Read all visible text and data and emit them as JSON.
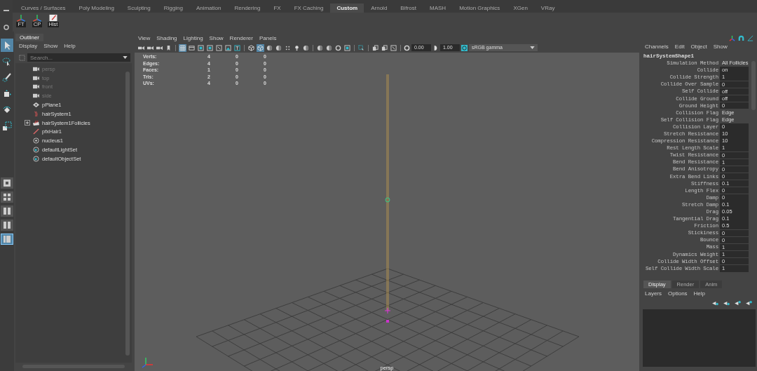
{
  "shelf": {
    "tabs": [
      {
        "label": "Curves / Surfaces",
        "selected": false
      },
      {
        "label": "Poly Modeling",
        "selected": false
      },
      {
        "label": "Sculpting",
        "selected": false
      },
      {
        "label": "Rigging",
        "selected": false
      },
      {
        "label": "Animation",
        "selected": false
      },
      {
        "label": "Rendering",
        "selected": false
      },
      {
        "label": "FX",
        "selected": false
      },
      {
        "label": "FX Caching",
        "selected": false
      },
      {
        "label": "Custom",
        "selected": true
      },
      {
        "label": "Arnold",
        "selected": false
      },
      {
        "label": "Bifrost",
        "selected": false
      },
      {
        "label": "MASH",
        "selected": false
      },
      {
        "label": "Motion Graphics",
        "selected": false
      },
      {
        "label": "XGen",
        "selected": false
      },
      {
        "label": "VRay",
        "selected": false
      }
    ],
    "buttons": [
      {
        "label": "FT",
        "kind": "axes"
      },
      {
        "label": "CP",
        "kind": "axes"
      },
      {
        "label": "Hist",
        "kind": "note"
      }
    ]
  },
  "toolbox": {
    "tools": [
      {
        "kind": "arrow",
        "selected": true
      },
      {
        "kind": "lasso",
        "selected": false
      },
      {
        "kind": "brush",
        "selected": false
      },
      {
        "kind": "move",
        "selected": false
      },
      {
        "kind": "rotate",
        "selected": false
      },
      {
        "kind": "scale",
        "selected": false
      }
    ],
    "layouts": [
      {
        "kind": "single",
        "selected": false
      },
      {
        "kind": "quad",
        "selected": false
      },
      {
        "kind": "split",
        "selected": false
      },
      {
        "kind": "split",
        "selected": false
      },
      {
        "kind": "outliner",
        "selected": true
      }
    ]
  },
  "outliner": {
    "tab": "Outliner",
    "menu": [
      "Display",
      "Show",
      "Help"
    ],
    "placeholder": "Search...",
    "items": [
      {
        "name": "persp",
        "kind": "camera",
        "hidden": true,
        "collapsed": false
      },
      {
        "name": "top",
        "kind": "camera",
        "hidden": true,
        "collapsed": false
      },
      {
        "name": "front",
        "kind": "camera",
        "hidden": true,
        "collapsed": false
      },
      {
        "name": "side",
        "kind": "camera",
        "hidden": true,
        "collapsed": false
      },
      {
        "name": "pPlane1",
        "kind": "mesh",
        "hidden": false,
        "collapsed": false
      },
      {
        "name": "hairSystem1",
        "kind": "hair",
        "hidden": false,
        "collapsed": false
      },
      {
        "name": "hairSystem1Follicles",
        "kind": "follicles",
        "hidden": false,
        "collapsed": true
      },
      {
        "name": "pfxHair1",
        "kind": "stroke",
        "hidden": false,
        "collapsed": false
      },
      {
        "name": "nucleus1",
        "kind": "nucleus",
        "hidden": false,
        "collapsed": false
      },
      {
        "name": "defaultLightSet",
        "kind": "set",
        "hidden": false,
        "collapsed": false
      },
      {
        "name": "defaultObjectSet",
        "kind": "set",
        "hidden": false,
        "collapsed": false
      }
    ]
  },
  "viewport": {
    "menu": [
      "View",
      "Shading",
      "Lighting",
      "Show",
      "Renderer",
      "Panels"
    ],
    "toolbar": [
      [
        {
          "kind": "camera",
          "selected": false
        },
        {
          "kind": "camera",
          "selected": false
        },
        {
          "kind": "camera",
          "selected": false
        },
        {
          "kind": "bookmark",
          "selected": false
        }
      ],
      [
        {
          "kind": "grid",
          "selected": true
        },
        {
          "kind": "film",
          "selected": false
        },
        {
          "kind": "square",
          "selected": false
        },
        {
          "kind": "square",
          "selected": false
        },
        {
          "kind": "frame",
          "selected": false
        },
        {
          "kind": "image",
          "selected": false
        },
        {
          "kind": "text",
          "selected": false
        }
      ],
      [
        {
          "kind": "cube",
          "selected": false
        },
        {
          "kind": "cube",
          "selected": true
        },
        {
          "kind": "sphere",
          "selected": false
        },
        {
          "kind": "sphere",
          "selected": false
        },
        {
          "kind": "dots",
          "selected": false
        },
        {
          "kind": "light",
          "selected": false
        },
        {
          "kind": "sphere",
          "selected": false
        }
      ],
      [
        {
          "kind": "sphere",
          "selected": false
        },
        {
          "kind": "sphere",
          "selected": false
        },
        {
          "kind": "ring",
          "selected": false
        },
        {
          "kind": "square",
          "selected": false
        }
      ],
      [
        {
          "kind": "select",
          "selected": false
        }
      ],
      [
        {
          "kind": "copy",
          "selected": false
        },
        {
          "kind": "copy",
          "selected": false
        },
        {
          "kind": "frame",
          "selected": false
        }
      ]
    ],
    "exposure": "0.00",
    "gamma": "1.00",
    "color_space": "sRGB gamma",
    "hud": [
      {
        "label": "Verts:",
        "values": [
          "4",
          "0",
          "0"
        ]
      },
      {
        "label": "Edges:",
        "values": [
          "4",
          "0",
          "0"
        ]
      },
      {
        "label": "Faces:",
        "values": [
          "1",
          "0",
          "0"
        ]
      },
      {
        "label": "Tris:",
        "values": [
          "2",
          "0",
          "0"
        ]
      },
      {
        "label": "UVs:",
        "values": [
          "4",
          "0",
          "0"
        ]
      }
    ],
    "camera": "persp"
  },
  "channel_box": {
    "menu": [
      "Channels",
      "Edit",
      "Object",
      "Show"
    ],
    "node": "hairSystemShape1",
    "attributes": [
      {
        "label": "Simulation Method",
        "value": "All Follicles",
        "kind": "enum"
      },
      {
        "label": "Collide",
        "value": "on",
        "kind": "field"
      },
      {
        "label": "Collide Strength",
        "value": "1",
        "kind": "field"
      },
      {
        "label": "Collide Over Sample",
        "value": "0",
        "kind": "field"
      },
      {
        "label": "Self Collide",
        "value": "off",
        "kind": "field"
      },
      {
        "label": "Collide Ground",
        "value": "off",
        "kind": "field"
      },
      {
        "label": "Ground Height",
        "value": "0",
        "kind": "field"
      },
      {
        "label": "Collision Flag",
        "value": "Edge",
        "kind": "enum"
      },
      {
        "label": "Self Collision Flag",
        "value": "Edge",
        "kind": "enum"
      },
      {
        "label": "Collision Layer",
        "value": "0",
        "kind": "field"
      },
      {
        "label": "Stretch Resistance",
        "value": "10",
        "kind": "field"
      },
      {
        "label": "Compression Resistance",
        "value": "10",
        "kind": "field"
      },
      {
        "label": "Rest Length Scale",
        "value": "1",
        "kind": "field"
      },
      {
        "label": "Twist Resistance",
        "value": "0",
        "kind": "field"
      },
      {
        "label": "Bend Resistance",
        "value": "1",
        "kind": "field"
      },
      {
        "label": "Bend Anisotropy",
        "value": "0",
        "kind": "field"
      },
      {
        "label": "Extra Bend Links",
        "value": "0",
        "kind": "field"
      },
      {
        "label": "Stiffness",
        "value": "0.1",
        "kind": "field"
      },
      {
        "label": "Length Flex",
        "value": "0",
        "kind": "field"
      },
      {
        "label": "Damp",
        "value": "0",
        "kind": "field"
      },
      {
        "label": "Stretch Damp",
        "value": "0.1",
        "kind": "field"
      },
      {
        "label": "Drag",
        "value": "0.05",
        "kind": "field"
      },
      {
        "label": "Tangential Drag",
        "value": "0.1",
        "kind": "field"
      },
      {
        "label": "Friction",
        "value": "0.5",
        "kind": "field"
      },
      {
        "label": "Stickiness",
        "value": "0",
        "kind": "field"
      },
      {
        "label": "Bounce",
        "value": "0",
        "kind": "field"
      },
      {
        "label": "Mass",
        "value": "1",
        "kind": "field"
      },
      {
        "label": "Dynamics Weight",
        "value": "1",
        "kind": "field"
      },
      {
        "label": "Collide Width Offset",
        "value": "0",
        "kind": "field"
      },
      {
        "label": "Self Collide Width Scale",
        "value": "1",
        "kind": "field"
      }
    ]
  },
  "layer_editor": {
    "tabs": [
      {
        "label": "Display",
        "selected": true
      },
      {
        "label": "Render",
        "selected": false
      },
      {
        "label": "Anim",
        "selected": false
      }
    ],
    "menu": [
      "Layers",
      "Options",
      "Help"
    ]
  }
}
